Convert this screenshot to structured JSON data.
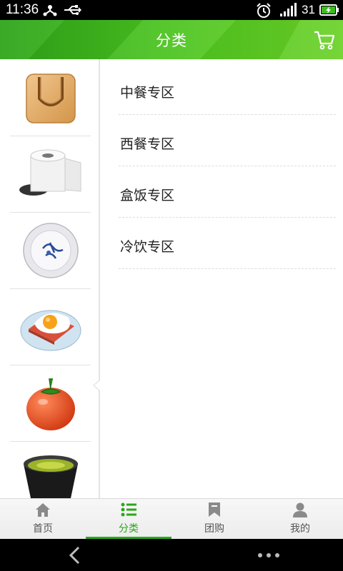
{
  "status_bar": {
    "time": "11:36",
    "battery_level": "31"
  },
  "header": {
    "title": "分类"
  },
  "sidebar": {
    "items": [
      {
        "name": "shopping-bag-icon"
      },
      {
        "name": "toilet-paper-icon"
      },
      {
        "name": "porcelain-plate-icon"
      },
      {
        "name": "fried-egg-toast-icon",
        "selected": true
      },
      {
        "name": "tomato-icon"
      },
      {
        "name": "green-tea-bowl-icon"
      }
    ]
  },
  "categories": [
    {
      "label": "中餐专区"
    },
    {
      "label": "西餐专区"
    },
    {
      "label": "盒饭专区"
    },
    {
      "label": "冷饮专区"
    }
  ],
  "tabs": [
    {
      "label": "首页",
      "icon": "home-icon"
    },
    {
      "label": "分类",
      "icon": "list-icon",
      "active": true
    },
    {
      "label": "团购",
      "icon": "bookmark-icon"
    },
    {
      "label": "我的",
      "icon": "user-icon"
    }
  ],
  "colors": {
    "accent": "#2ca61c",
    "header": "#49c21f"
  }
}
